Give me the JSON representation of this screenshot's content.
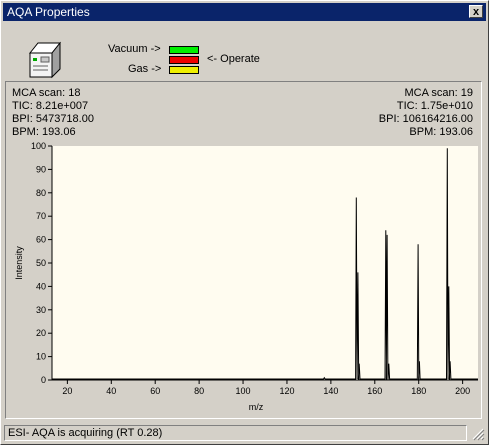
{
  "window": {
    "title": "AQA Properties",
    "close_glyph": "x"
  },
  "instrument": {
    "icon": "instrument-icon",
    "vacuum_label": "Vacuum ->",
    "operate_label": "<- Operate",
    "gas_label": "Gas ->",
    "lamps": {
      "vacuum": "#00ee00",
      "operate": "#ee0000",
      "gas": "#eeee00"
    }
  },
  "scans": {
    "left": {
      "mca_scan": "MCA scan: 18",
      "tic": "TIC: 8.21e+007",
      "bpi": "BPI: 5473718.00",
      "bpm": "BPM: 193.06"
    },
    "right": {
      "mca_scan": "MCA scan: 19",
      "tic": "TIC: 1.75e+010",
      "bpi": "BPI: 106164216.00",
      "bpm": "BPM: 193.06"
    }
  },
  "chart_data": {
    "type": "line",
    "xlabel": "m/z",
    "ylabel": "Intensity",
    "xlim": [
      13,
      207
    ],
    "ylim": [
      0,
      100
    ],
    "x_ticks": [
      20,
      40,
      60,
      80,
      100,
      120,
      140,
      160,
      180,
      200
    ],
    "y_ticks": [
      0,
      10,
      20,
      30,
      40,
      50,
      60,
      70,
      80,
      90,
      100
    ],
    "background": "#fffcf0",
    "series": [
      {
        "peaks": [
          {
            "x": 137.0,
            "y": 1
          },
          {
            "x": 151.6,
            "y": 78
          },
          {
            "x": 152.3,
            "y": 46
          },
          {
            "x": 152.9,
            "y": 7
          },
          {
            "x": 165.0,
            "y": 64
          },
          {
            "x": 165.6,
            "y": 62
          },
          {
            "x": 166.4,
            "y": 7
          },
          {
            "x": 179.7,
            "y": 58
          },
          {
            "x": 180.3,
            "y": 8
          },
          {
            "x": 193.0,
            "y": 99
          },
          {
            "x": 193.7,
            "y": 40
          },
          {
            "x": 194.3,
            "y": 8
          }
        ]
      }
    ]
  },
  "status_bar": {
    "text": "ESI- AQA is acquiring (RT 0.28)"
  }
}
